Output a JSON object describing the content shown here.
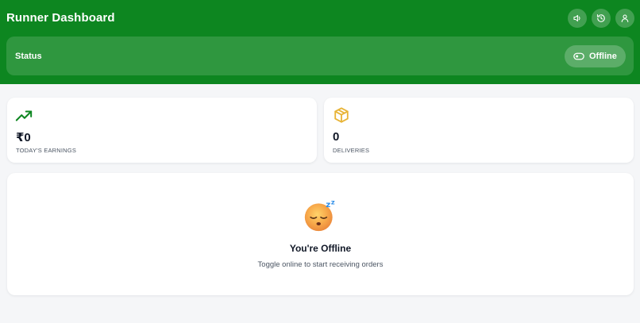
{
  "header": {
    "title": "Runner Dashboard",
    "icons": [
      "speaker-icon",
      "history-icon",
      "user-icon"
    ],
    "background": "#0d8620"
  },
  "status": {
    "label": "Status",
    "toggle_label": "Offline",
    "toggle_icon": "toggle-off-icon",
    "is_online": false
  },
  "stats": [
    {
      "icon": "trending-up-icon",
      "value": "₹0",
      "label": "TODAY'S EARNINGS",
      "accent": "#0d8620"
    },
    {
      "icon": "package-icon",
      "value": "0",
      "label": "DELIVERIES",
      "accent": "#e8b437"
    }
  ],
  "offline_panel": {
    "emoji": "sleeping-face-icon",
    "title": "You're Offline",
    "subtitle": "Toggle online to start receiving orders"
  }
}
